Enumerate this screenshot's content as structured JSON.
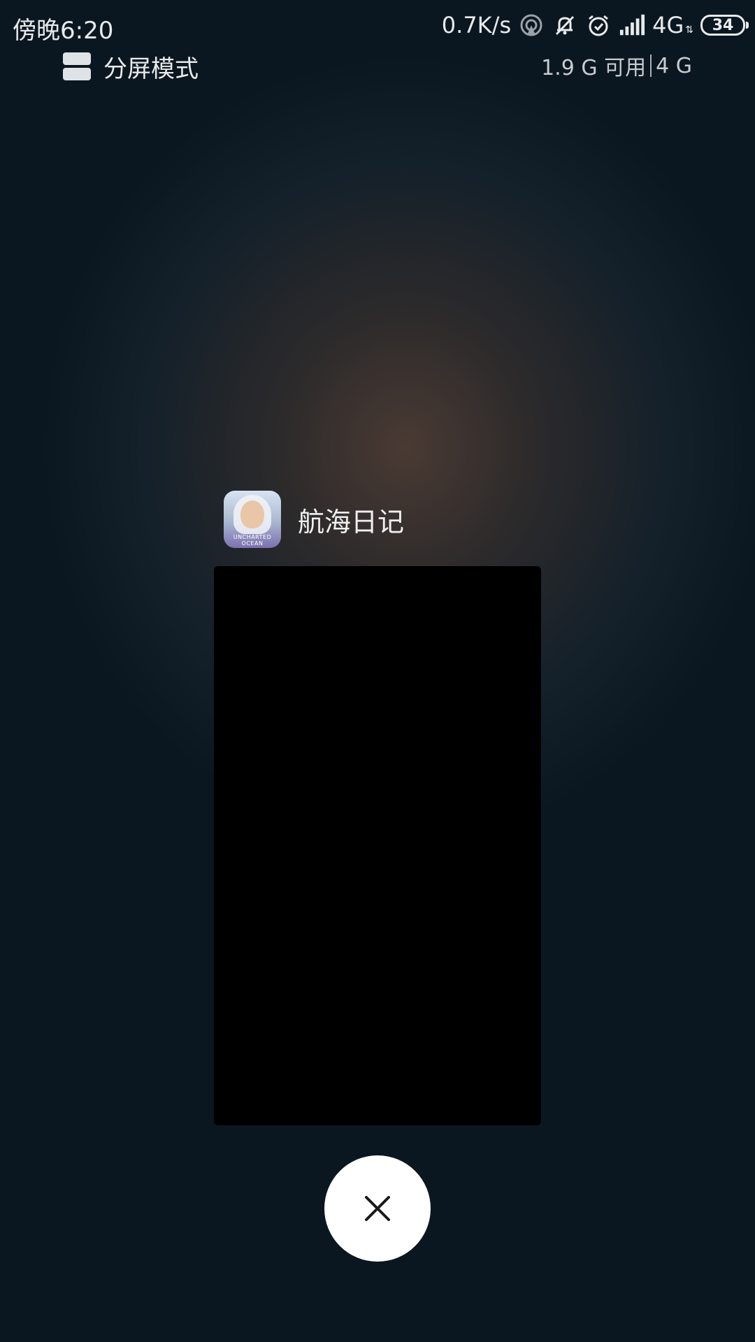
{
  "status_bar": {
    "time": "傍晚6:20",
    "network_speed": "0.7K/s",
    "network_type": "4G",
    "battery_level": "34",
    "icons": [
      "hotspot-icon",
      "bell-muted-icon",
      "alarm-icon",
      "signal-icon"
    ]
  },
  "header": {
    "split_mode_label": "分屏模式",
    "memory_available": "1.9 G 可用",
    "memory_total": "4 G"
  },
  "recent_app": {
    "title": "航海日记",
    "icon_text": "UNCHARTED OCEAN",
    "icon": "app-icon-uncharted-ocean"
  },
  "actions": {
    "close_icon": "close-icon"
  },
  "colors": {
    "background": "#0b1720",
    "glow": "#4a3a33",
    "preview": "#000000",
    "close_button": "#ffffff"
  }
}
